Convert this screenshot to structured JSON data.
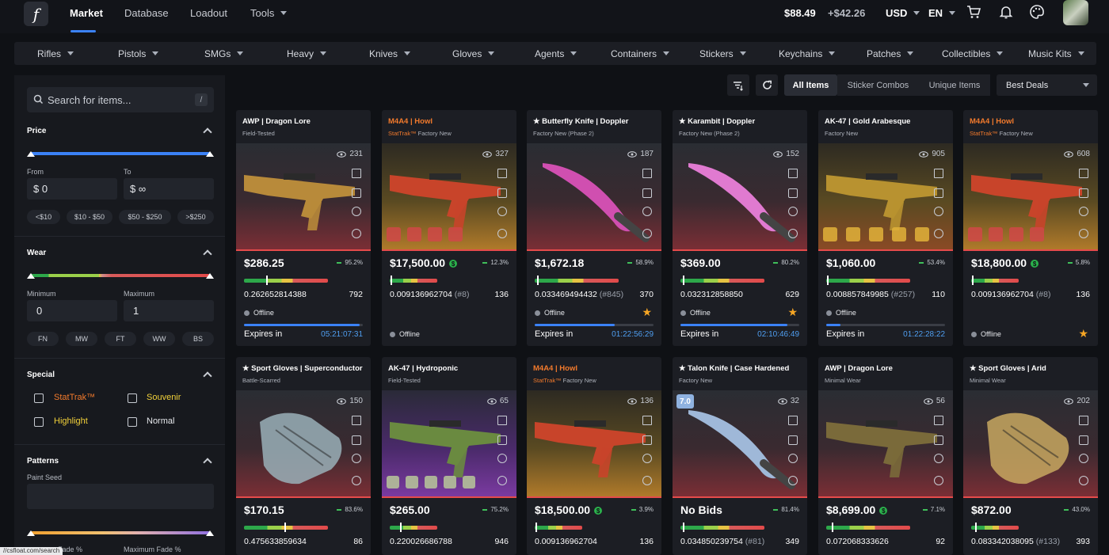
{
  "topbar": {
    "logo": "f",
    "nav": [
      "Market",
      "Database",
      "Loadout",
      "Tools"
    ],
    "balance": "$88.49",
    "pending": "+$42.26",
    "currency": "USD",
    "language": "EN"
  },
  "categories": [
    "Rifles",
    "Pistols",
    "SMGs",
    "Heavy",
    "Knives",
    "Gloves",
    "Agents",
    "Containers",
    "Stickers",
    "Keychains",
    "Patches",
    "Collectibles",
    "Music Kits"
  ],
  "sidebar": {
    "search_placeholder": "Search for items...",
    "search_shortcut": "/",
    "price": {
      "title": "Price",
      "from_label": "From",
      "to_label": "To",
      "from_value": "$  0",
      "to_value": "$  ∞",
      "chips": [
        "<$10",
        "$10 - $50",
        "$50 - $250",
        ">$250"
      ]
    },
    "wear": {
      "title": "Wear",
      "min_label": "Minimum",
      "max_label": "Maximum",
      "min_value": "0",
      "max_value": "1",
      "chips": [
        "FN",
        "MW",
        "FT",
        "WW",
        "BS"
      ]
    },
    "special": {
      "title": "Special",
      "options": [
        "StatTrak™",
        "Souvenir",
        "Highlight",
        "Normal"
      ]
    },
    "patterns": {
      "title": "Patterns",
      "paint_seed": "Paint Seed",
      "min_fade": "Minimum Fade %",
      "max_fade": "Maximum Fade %"
    }
  },
  "toolbar": {
    "tabs": [
      "All Items",
      "Sticker Combos",
      "Unique Items"
    ],
    "sort": "Best Deals"
  },
  "cards": [
    {
      "name": "AWP | Dragon Lore",
      "sub": "Field-Tested",
      "views": "231",
      "price": "$286.25",
      "pct": "95.2%",
      "float": "0.262652814388",
      "pid": "",
      "count": "792",
      "status": "Offline",
      "expires_label": "Expires in",
      "expires": "05:21:07:31",
      "progress": 0.97,
      "wear": 0.26
    },
    {
      "name": "M4A4 | Howl",
      "st": "StatTrak™",
      "sub": " Factory New",
      "views": "327",
      "price": "$17,500.00",
      "pct": "12.3%",
      "float": "0.009136962704",
      "pid": "(#8)",
      "count": "136",
      "status": "Offline",
      "wear": 0.01,
      "dollar": true
    },
    {
      "name": "★ Butterfly Knife | Doppler",
      "sub": "Factory New (Phase 2)",
      "views": "187",
      "price": "$1,672.18",
      "pct": "58.9%",
      "float": "0.033469494432",
      "pid": "(#845)",
      "count": "370",
      "status": "Offline",
      "expires_label": "Expires in",
      "expires": "01:22:56:29",
      "progress": 0.67,
      "wear": 0.03,
      "star": "★"
    },
    {
      "name": "★ Karambit | Doppler",
      "sub": "Factory New (Phase 2)",
      "views": "152",
      "price": "$369.00",
      "pct": "80.2%",
      "float": "0.032312858850",
      "pid": "",
      "count": "629",
      "status": "Offline",
      "expires_label": "Expires in",
      "expires": "02:10:46:49",
      "progress": 0.9,
      "wear": 0.03,
      "star": "★"
    },
    {
      "name": "AK-47 | Gold Arabesque",
      "sub": "Factory New",
      "views": "905",
      "price": "$1,060.00",
      "pct": "53.4%",
      "float": "0.008857849985",
      "pid": "(#257)",
      "count": "110",
      "status": "Offline",
      "expires_label": "Expires in",
      "expires": "01:22:28:22",
      "progress": 0.12,
      "wear": 0.01
    },
    {
      "name": "M4A4 | Howl",
      "st": "StatTrak™",
      "sub": " Factory New",
      "views": "608",
      "price": "$18,800.00",
      "pct": "5.8%",
      "float": "0.009136962704",
      "pid": "(#8)",
      "count": "136",
      "status": "Offline",
      "wear": 0.01,
      "dollar": true,
      "star": "★"
    },
    {
      "name": "★ Sport Gloves | Superconductor",
      "sub": "Battle-Scarred",
      "views": "150",
      "price": "$170.15",
      "pct": "83.6%",
      "float": "0.475633859634",
      "pid": "",
      "count": "86",
      "wear": 0.48
    },
    {
      "name": "AK-47 | Hydroponic",
      "sub": "Field-Tested",
      "views": "65",
      "price": "$265.00",
      "pct": "75.2%",
      "float": "0.220026686788",
      "pid": "",
      "count": "946",
      "wear": 0.22
    },
    {
      "name": "M4A4 | Howl",
      "st": "StatTrak™",
      "sub": " Factory New",
      "views": "136",
      "price": "$18,500.00",
      "pct": "3.9%",
      "float": "0.009136962704",
      "pid": "",
      "count": "136",
      "wear": 0.01,
      "dollar": true
    },
    {
      "name": "★ Talon Knife | Case Hardened",
      "sub": "Factory New",
      "views": "32",
      "price": "No Bids",
      "pct": "81.4%",
      "float": "0.034850239754",
      "pid": "(#81)",
      "count": "349",
      "wear": 0.03,
      "badge": "7.0"
    },
    {
      "name": "AWP | Dragon Lore",
      "sub": "Minimal Wear",
      "views": "56",
      "price": "$8,699.00",
      "pct": "7.1%",
      "float": "0.072068333626",
      "pid": "",
      "count": "92",
      "wear": 0.07,
      "dollar": true
    },
    {
      "name": "★ Sport Gloves | Arid",
      "sub": "Minimal Wear",
      "views": "202",
      "price": "$872.00",
      "pct": "43.0%",
      "float": "0.083342038095",
      "pid": "(#133)",
      "count": "393",
      "wear": 0.08
    }
  ],
  "status_url": "//csfloat.com/search"
}
